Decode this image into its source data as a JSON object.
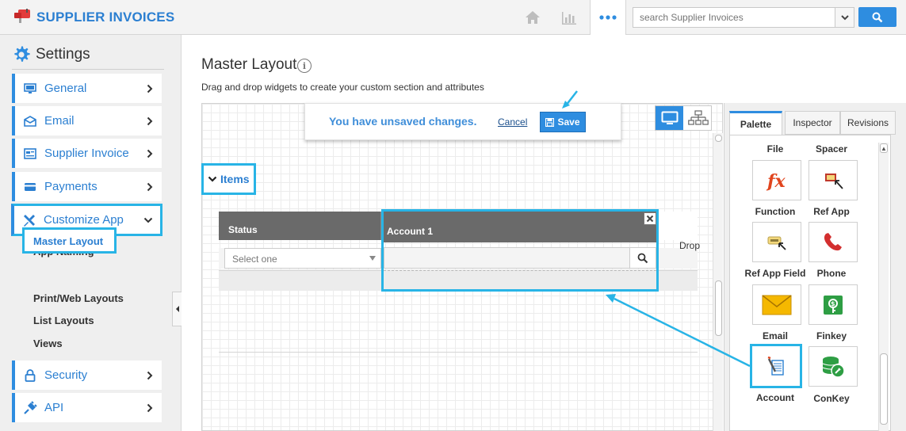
{
  "colors": {
    "accent": "#2e8de0",
    "highlight": "#28b4e6",
    "header_gray": "#6a6a6a"
  },
  "header": {
    "app_title": "SUPPLIER INVOICES",
    "search_placeholder": "search Supplier Invoices",
    "icons": [
      "mailbox-icon",
      "home-icon",
      "bar-chart-icon",
      "more-icon",
      "chevron-down-icon",
      "search-icon"
    ]
  },
  "sidebar": {
    "title": "Settings",
    "items": [
      {
        "label": "General",
        "icon": "monitor-icon"
      },
      {
        "label": "Email",
        "icon": "envelope-icon"
      },
      {
        "label": "Supplier Invoice",
        "icon": "invoice-icon"
      },
      {
        "label": "Payments",
        "icon": "credit-card-icon"
      },
      {
        "label": "Customize App",
        "icon": "tools-icon",
        "expanded": true
      },
      {
        "label": "Security",
        "icon": "lock-icon"
      },
      {
        "label": "API",
        "icon": "plug-icon"
      }
    ],
    "subitems": [
      "App Naming",
      "Master Layout",
      "Print/Web Layouts",
      "List Layouts",
      "Views"
    ],
    "active_subitem": "Master Layout"
  },
  "main": {
    "title": "Master Layout",
    "description": "Drag and drop widgets to create your custom section and attributes",
    "unsaved_message": "You have unsaved changes.",
    "cancel_label": "Cancel",
    "save_label": "Save",
    "section_label": "Items",
    "table": {
      "columns": [
        "Status",
        "Account 1"
      ],
      "status_placeholder": "Select one",
      "truncated_column": "Drop"
    }
  },
  "panel": {
    "tabs": [
      "Palette",
      "Inspector",
      "Revisions"
    ],
    "active_tab": "Palette",
    "widgets_top": [
      "File",
      "Spacer"
    ],
    "widgets": [
      {
        "label": "Function",
        "icon": "function-fx-icon"
      },
      {
        "label": "Ref App",
        "icon": "ref-app-icon"
      },
      {
        "label": "Ref App Field",
        "icon": "ref-app-field-icon"
      },
      {
        "label": "Phone",
        "icon": "phone-icon"
      },
      {
        "label": "Email",
        "icon": "email-envelope-icon"
      },
      {
        "label": "Finkey",
        "icon": "finkey-icon"
      },
      {
        "label": "Account",
        "icon": "account-ledger-icon",
        "highlighted": true
      },
      {
        "label": "ConKey",
        "icon": "conkey-coins-icon"
      }
    ]
  }
}
